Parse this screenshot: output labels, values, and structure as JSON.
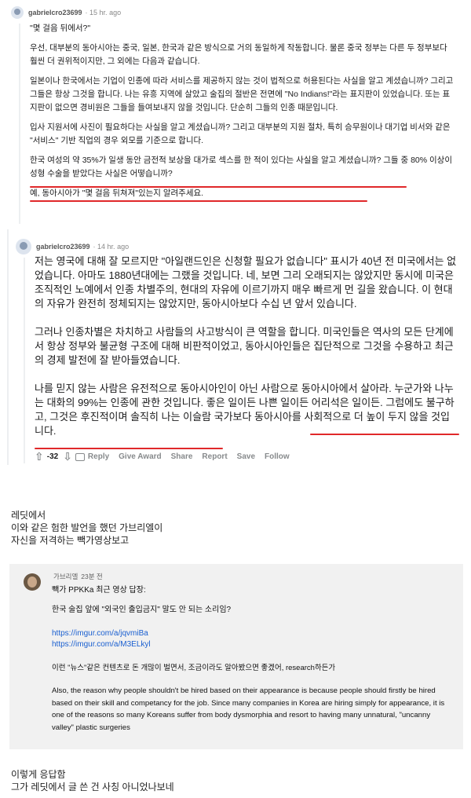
{
  "comment1": {
    "username": "gabrielcro23699",
    "time": "· 15 hr. ago",
    "paragraphs": [
      "\"몇 걸음 뒤에서?\"",
      "우선, 대부분의 동아시아는 중국, 일본, 한국과 같은 방식으로 거의 동일하게 작동합니다. 물론 중국 정부는 다른 두 정부보다 훨씬 더 권위적이지만, 그 외에는 다음과 같습니다.",
      "일본이나 한국에서는 기업이 인종에 따라 서비스를 제공하지 않는 것이 법적으로 허용된다는 사실을 알고 계셨습니까? 그리고 그들은 항상 그것을 합니다. 나는 유흥 지역에 살았고 술집의 절반은 전면에 \"No Indians!\"라는 표지판이 있었습니다. 또는 표지판이 없으면 경비원은 그들을 들여보내지 않을 것입니다. 단순히 그들의 인종 때문입니다.",
      "입사 지원서에 사진이 필요하다는 사실을 알고 계셨습니까? 그리고 대부분의 지원 절차, 특히 승무원이나 대기업 비서와 같은 \"서비스\" 기반 직업의 경우 외모를 기준으로 합니다.",
      "한국 여성의 약 35%가 일생 동안 금전적 보상을 대가로 섹스를 한 적이 있다는 사실을 알고 계셨습니까? 그들 중 80% 이상이 성형 수술을 받았다는 사실은 어떻습니까?",
      "예, 동아시아가 \"몇 걸음 뒤쳐져\"있는지 알려주세요."
    ]
  },
  "comment2": {
    "username": "gabrielcro23699",
    "time": "· 14 hr. ago",
    "paragraphs": [
      "저는 영국에 대해 잘 모르지만 \"아일랜드인은 신청할 필요가 없습니다\" 표시가 40년 전 미국에서는 없었습니다. 아마도 1880년대에는 그랬을 것입니다. 네, 보면 그리 오래되지는 않았지만 동시에 미국은 조직적인 노예에서 인종 차별주의, 현대의 자유에 이르기까지 매우 빠르게 먼 길을 왔습니다. 이 현대의 자유가 완전히 정체되지는 않았지만, 동아시아보다 수십 년 앞서 있습니다.",
      "그러나 인종차별은 차치하고 사람들의 사고방식이 큰 역할을 합니다. 미국인들은 역사의 모든 단계에서 항상 정부와 불균형 구조에 대해 비판적이었고, 동아시아인들은 집단적으로 그것을 수용하고 최근의 경제 발전에 잘 받아들였습니다.",
      "나를 믿지 않는 사람은 유전적으로 동아시아인이 아닌 사람으로 동아시아에서 살아라. 누군가와 나누는 대화의 99%는 인종에 관한 것입니다. 좋은 일이든 나쁜 일이든 어리석은 일이든. 그럼에도 불구하고, 그것은 후진적이며 솔직히 나는 이슬람 국가보다 동아시아를 사회적으로 더 높이 두지 않을 것입니다."
    ],
    "actions": {
      "score": "-32",
      "reply": "Reply",
      "give_award": "Give Award",
      "share": "Share",
      "report": "Report",
      "save": "Save",
      "follow": "Follow"
    }
  },
  "caption1": [
    "레딧에서",
    "이와 같은 험한 발언을 했던 가브리엘이",
    "자신을 저격하는 빽가영상보고"
  ],
  "youtube_reply": {
    "username": "가브리엘",
    "time": "23분 전",
    "reply_to": "빽가 PPKKa 최근 영상 답장:",
    "question": "한국 술집 앞에 \"외국인 출입금지\" 말도 안 되는 소리임?",
    "links": [
      "https://imgur.com/a/jqvmiBa",
      "https://imgur.com/a/M3ELkyl"
    ],
    "korean_line": "이런 \"뉴스\"같은 컨텐츠로 돈 개많이 벌면서, 조금이라도 알아봤으면 좋겠어, research하든가",
    "english": "Also, the reason why people shouldn't be hired based on their appearance is because people should firstly be hired based on their skill and competancy for the job. Since many companies in Korea are hiring simply for appearance, it is one of the reasons so many Koreans suffer from body dysmorphia and resort to having many unnatural, \"uncanny valley\" plastic surgeries"
  },
  "caption2": [
    "이렇게 응답함",
    "그가 레딧에서 글 쓴 건 사칭 아니었나보네"
  ],
  "colors": {
    "underline": "#e0282a",
    "link": "#1a5fd0",
    "youtube_bg": "#f1f1f1"
  }
}
